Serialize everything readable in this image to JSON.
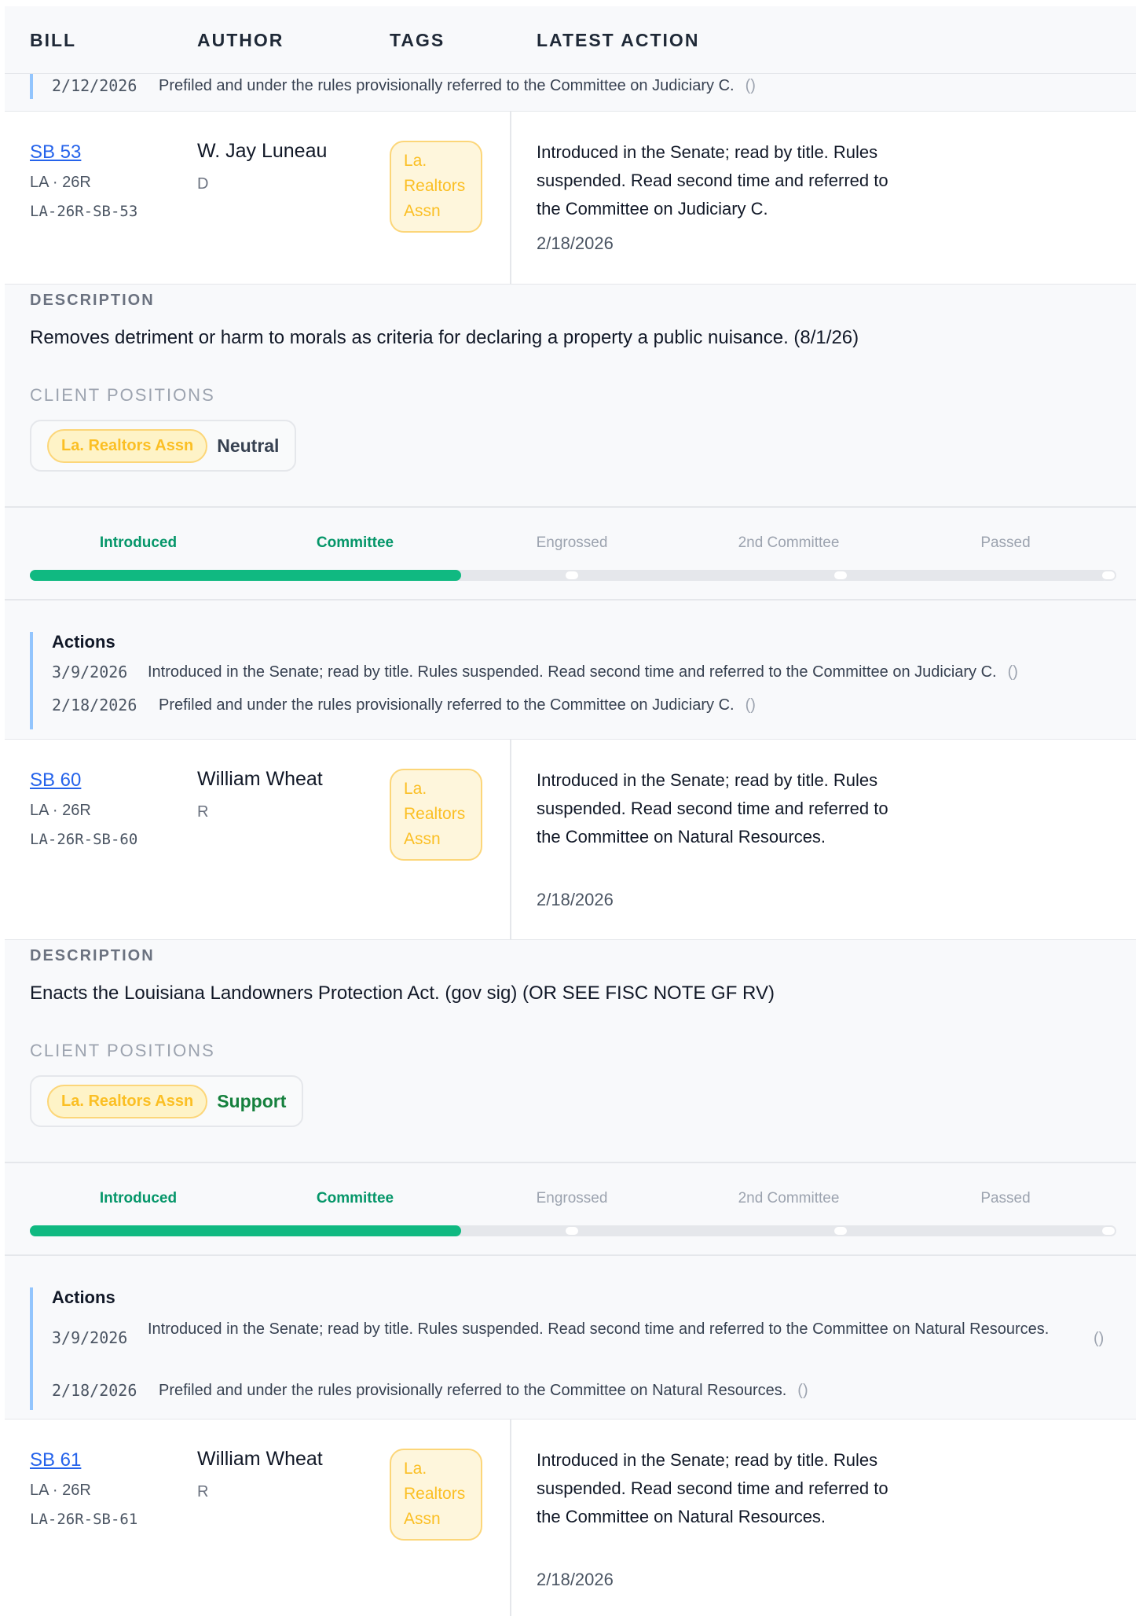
{
  "header": {
    "col_bill": "BILL",
    "col_author": "AUTHOR",
    "col_tags": "TAGS",
    "col_latest": "LATEST ACTION"
  },
  "top_partial_action": {
    "date": "2/12/2026",
    "text": "Prefiled and under the rules provisionally referred to the Committee on Judiciary C.",
    "link": "()"
  },
  "stages": [
    "Introduced",
    "Committee",
    "Engrossed",
    "2nd Committee",
    "Passed"
  ],
  "labels": {
    "description": "DESCRIPTION",
    "client_positions": "CLIENT POSITIONS",
    "actions": "Actions"
  },
  "colors": {
    "support": "#15803d",
    "neutral": "#374151",
    "tag": "#fbbf24",
    "progress": "#10b981"
  },
  "bills": [
    {
      "bill": "SB 53",
      "meta": "LA · 26R",
      "id": "LA-26R-SB-53",
      "author": "W. Jay Luneau",
      "party": "D",
      "tag": "La. Realtors Assn",
      "latest_action": "Introduced in the Senate; read by title. Rules suspended. Read second time and referred to the Committee on Judiciary C.",
      "latest_date": "2/18/2026",
      "description": "Removes detriment or harm to morals as criteria for declaring a property a public nuisance. (8/1/26)",
      "client": "La. Realtors Assn",
      "position": "Neutral",
      "progress": 0.4,
      "actions": [
        {
          "date": "3/9/2026",
          "text": "Introduced in the Senate; read by title. Rules suspended. Read second time and referred to the Committee on Judiciary C.",
          "link": "()"
        },
        {
          "date": "2/18/2026",
          "text": "Prefiled and under the rules provisionally referred to the Committee on Judiciary C.",
          "link": "()"
        }
      ]
    },
    {
      "bill": "SB 60",
      "meta": "LA · 26R",
      "id": "LA-26R-SB-60",
      "author": "William Wheat",
      "party": "R",
      "tag": "La. Realtors Assn",
      "latest_action": "Introduced in the Senate; read by title. Rules suspended. Read second time and referred to the Committee on Natural Resources.",
      "latest_date": "2/18/2026",
      "description": "Enacts the Louisiana Landowners Protection Act. (gov sig) (OR SEE FISC NOTE GF RV)",
      "client": "La. Realtors Assn",
      "position": "Support",
      "progress": 0.4,
      "actions": [
        {
          "date": "3/9/2026",
          "text": "Introduced in the Senate; read by title. Rules suspended. Read second time and referred to the Committee on Natural Resources.",
          "link": "()"
        },
        {
          "date": "2/18/2026",
          "text": "Prefiled and under the rules provisionally referred to the Committee on Natural Resources.",
          "link": "()"
        }
      ]
    },
    {
      "bill": "SB 61",
      "meta": "LA · 26R",
      "id": "LA-26R-SB-61",
      "author": "William Wheat",
      "party": "R",
      "tag": "La. Realtors Assn",
      "latest_action": "Introduced in the Senate; read by title. Rules suspended. Read second time and referred to the Committee on Natural Resources.",
      "latest_date": "2/18/2026"
    }
  ]
}
